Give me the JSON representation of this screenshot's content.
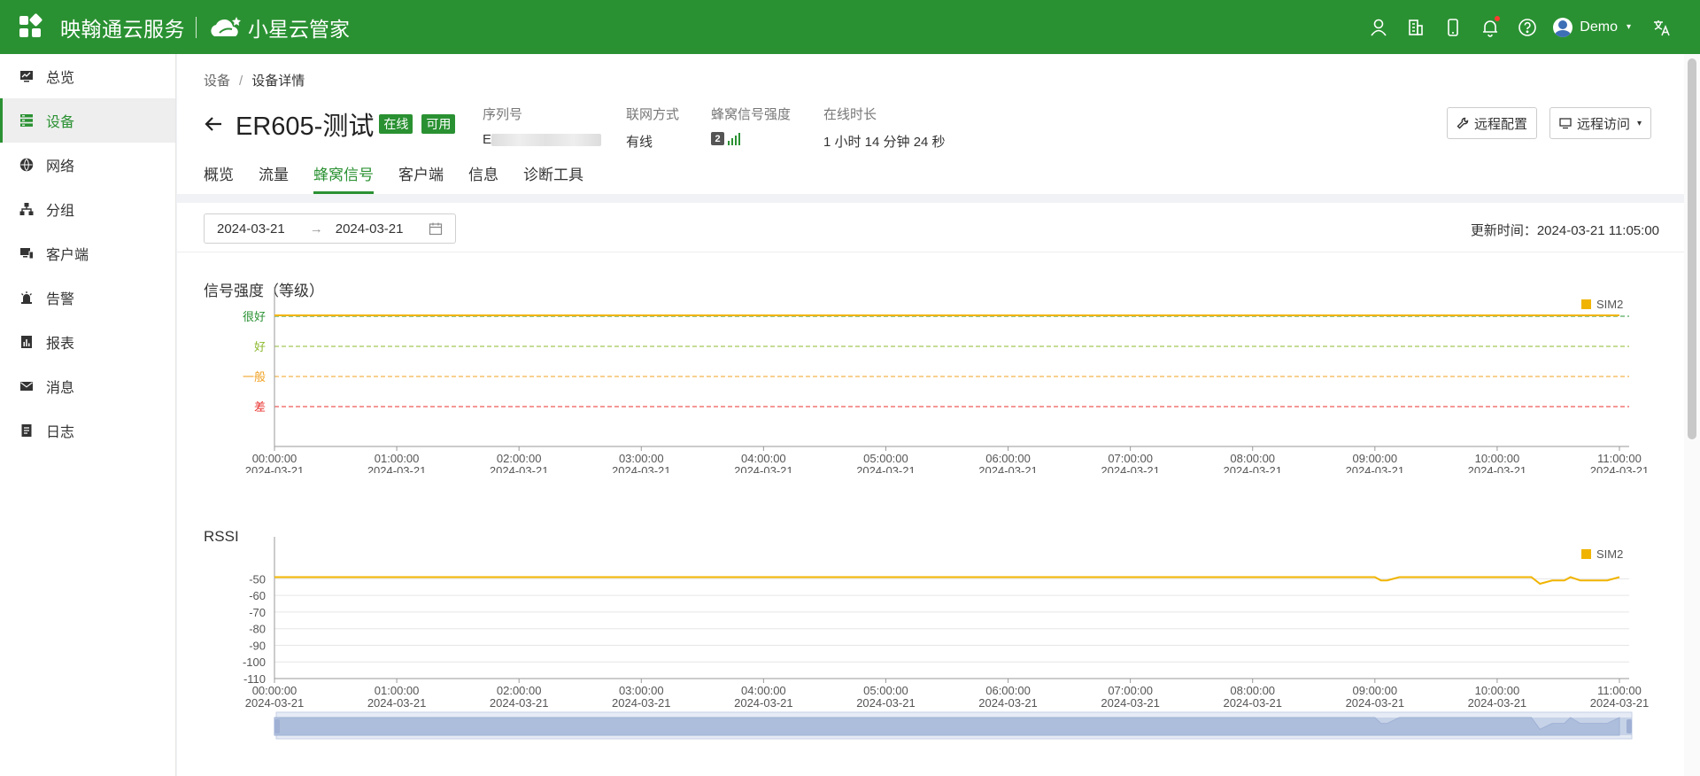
{
  "topbar": {
    "brand": "映翰通云服务",
    "brand2": "小星云管家",
    "user": "Demo"
  },
  "sidebar": {
    "items": [
      {
        "label": "总览",
        "icon": "monitor-icon"
      },
      {
        "label": "设备",
        "icon": "server-icon"
      },
      {
        "label": "网络",
        "icon": "globe-icon"
      },
      {
        "label": "分组",
        "icon": "hierarchy-icon"
      },
      {
        "label": "客户端",
        "icon": "devices-icon"
      },
      {
        "label": "告警",
        "icon": "alarm-icon"
      },
      {
        "label": "报表",
        "icon": "report-icon"
      },
      {
        "label": "消息",
        "icon": "mail-icon"
      },
      {
        "label": "日志",
        "icon": "log-icon"
      }
    ],
    "active_index": 1
  },
  "breadcrumb": {
    "root": "设备",
    "sep": "/",
    "current": "设备详情"
  },
  "device": {
    "name": "ER605-测试",
    "badge_online": "在线",
    "badge_available": "可用",
    "serial_label": "序列号",
    "serial_value": "E",
    "network_label": "联网方式",
    "network_value": "有线",
    "signal_label": "蜂窝信号强度",
    "signal_sim": "2",
    "uptime_label": "在线时长",
    "uptime_value": "1 小时 14 分钟 24 秒"
  },
  "buttons": {
    "remote_config": "远程配置",
    "remote_access": "远程访问"
  },
  "tabs": [
    "概览",
    "流量",
    "蜂窝信号",
    "客户端",
    "信息",
    "诊断工具"
  ],
  "active_tab": 2,
  "filter": {
    "start_date": "2024-03-21",
    "arrow": "→",
    "end_date": "2024-03-21",
    "update_label": "更新时间：",
    "update_value": "2024-03-21 11:05:00"
  },
  "colors": {
    "accent": "#2a9132",
    "sim2": "#f0b400"
  },
  "chart_data": [
    {
      "type": "line",
      "title": "信号强度（等级）",
      "legend": [
        "SIM2"
      ],
      "legend_position": "top-right",
      "y_categories": [
        "差",
        "一般",
        "好",
        "很好"
      ],
      "y_category_colors": [
        "#e8322e",
        "#f0a020",
        "#8cb82c",
        "#2a9132"
      ],
      "x_ticks": [
        [
          "00:00:00",
          "2024-03-21"
        ],
        [
          "01:00:00",
          "2024-03-21"
        ],
        [
          "02:00:00",
          "2024-03-21"
        ],
        [
          "03:00:00",
          "2024-03-21"
        ],
        [
          "04:00:00",
          "2024-03-21"
        ],
        [
          "05:00:00",
          "2024-03-21"
        ],
        [
          "06:00:00",
          "2024-03-21"
        ],
        [
          "07:00:00",
          "2024-03-21"
        ],
        [
          "08:00:00",
          "2024-03-21"
        ],
        [
          "09:00:00",
          "2024-03-21"
        ],
        [
          "10:00:00",
          "2024-03-21"
        ],
        [
          "11:00:00",
          "2024-03-21"
        ]
      ],
      "series": [
        {
          "name": "SIM2",
          "x": [
            0,
            11
          ],
          "values": [
            "很好",
            "很好"
          ]
        }
      ]
    },
    {
      "type": "line",
      "title": "RSSI",
      "legend": [
        "SIM2"
      ],
      "legend_position": "top-right",
      "y_ticks": [
        -50,
        -60,
        -70,
        -80,
        -90,
        -100,
        -110
      ],
      "ylim": [
        -110,
        -45
      ],
      "x_ticks": [
        [
          "00:00:00",
          "2024-03-21"
        ],
        [
          "01:00:00",
          "2024-03-21"
        ],
        [
          "02:00:00",
          "2024-03-21"
        ],
        [
          "03:00:00",
          "2024-03-21"
        ],
        [
          "04:00:00",
          "2024-03-21"
        ],
        [
          "05:00:00",
          "2024-03-21"
        ],
        [
          "06:00:00",
          "2024-03-21"
        ],
        [
          "07:00:00",
          "2024-03-21"
        ],
        [
          "08:00:00",
          "2024-03-21"
        ],
        [
          "09:00:00",
          "2024-03-21"
        ],
        [
          "10:00:00",
          "2024-03-21"
        ],
        [
          "11:00:00",
          "2024-03-21"
        ]
      ],
      "series": [
        {
          "name": "SIM2",
          "x": [
            0,
            9.0,
            9.05,
            9.1,
            9.2,
            10.2,
            10.28,
            10.35,
            10.45,
            10.55,
            10.6,
            10.68,
            10.9,
            11.0
          ],
          "values": [
            -49,
            -49,
            -51,
            -51,
            -49,
            -49,
            -49,
            -53,
            -51,
            -51,
            -49,
            -51,
            -51,
            -49
          ]
        }
      ]
    }
  ]
}
